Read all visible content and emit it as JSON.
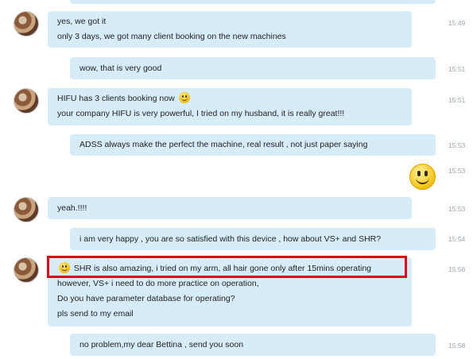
{
  "messages": [
    {
      "sender": "them",
      "lines": [
        "yes, we got it",
        "only 3 days, we got many client booking on the new machines"
      ],
      "time": "15:49"
    },
    {
      "sender": "me",
      "lines": [
        "wow, that is very good"
      ],
      "time": "15:51"
    },
    {
      "sender": "them",
      "lines": [
        "HIFU has 3 clients booking now",
        "your company HIFU is very powerful, I tried on my husband, it is really great!!!"
      ],
      "time": "15:51",
      "emoji_after_line_1": "smile-emoji"
    },
    {
      "sender": "me",
      "lines": [
        "ADSS always make the perfect the machine, real result , not just paper saying"
      ],
      "time": "15:53"
    },
    {
      "sender": "me",
      "lines": [],
      "time": "15:53",
      "emoji": "big-smile-emoji"
    },
    {
      "sender": "them",
      "lines": [
        "yeah.!!!!"
      ],
      "time": "15:53"
    },
    {
      "sender": "me",
      "lines": [
        "i am very happy , you are so satisfied with this device , how about VS+ and SHR?"
      ],
      "time": "15:54"
    },
    {
      "sender": "them",
      "lines": [
        "SHR is also amazing, i tried on my arm, all hair gone only after 15mins operating",
        "however, VS+ i need to do more practice on operation,",
        "Do you have parameter database for operating?",
        "pls send to my email"
      ],
      "time": "15:56",
      "emoji_before_line_1": "smile-emoji",
      "highlighted_line": 1
    },
    {
      "sender": "me",
      "lines": [
        "no problem,my dear Bettina , send you soon"
      ],
      "time": "15:58"
    }
  ],
  "colors": {
    "bubble": "#d7ecf9",
    "highlight": "#e0001a",
    "timestamp": "#9aa6b0"
  }
}
